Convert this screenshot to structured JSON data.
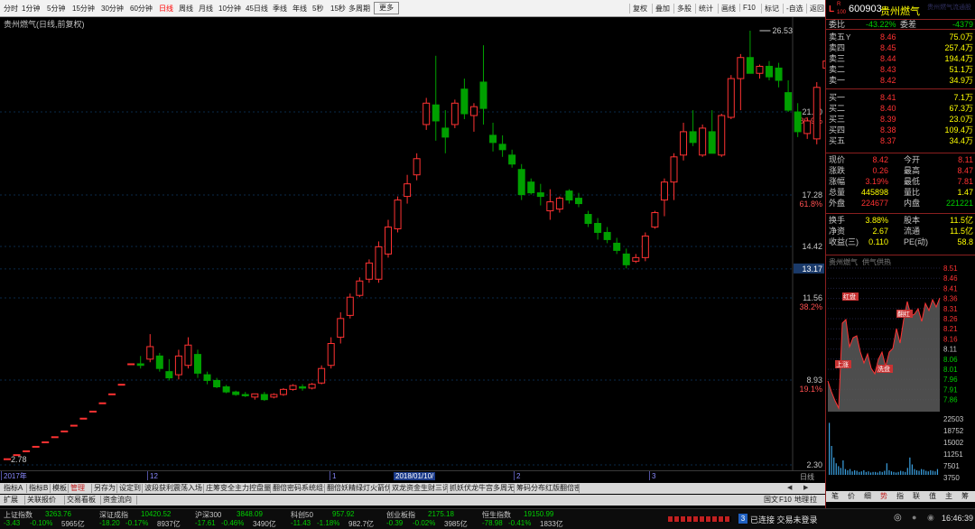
{
  "colors": {
    "up": "#ff3232",
    "down": "#00a000",
    "price": "#ffff00",
    "text": "#c8c8c8",
    "label_red": "#ff5050",
    "label_blue": "#5ab4ff"
  },
  "period_tabs": [
    "分时",
    "1分钟",
    "5分钟",
    "15分钟",
    "30分钟",
    "60分钟",
    "日线",
    "周线",
    "月线",
    "10分钟",
    "45日线",
    "季线",
    "年线",
    "5秒",
    "15秒",
    "多周期",
    "更多"
  ],
  "active_period": "日线",
  "tool_tabs": [
    "复权",
    "叠加",
    "多股",
    "统计",
    "画线",
    "F10",
    "标记",
    "-自选",
    "返回"
  ],
  "chart": {
    "title": "贵州燃气(日线,前复权)",
    "price_labels": [
      {
        "value": "21.90",
        "pct": "80.9%"
      },
      {
        "value": "17.28",
        "pct": "61.8%"
      },
      {
        "value": "14.42",
        "pct": ""
      },
      {
        "value": "13.17",
        "pct": ""
      },
      {
        "value": "11.56",
        "pct": "38.2%"
      },
      {
        "value": "8.93",
        "pct": "19.1%"
      },
      {
        "value": "2.30",
        "pct": ""
      }
    ],
    "high_marker": "26.53",
    "low_marker": "2.78",
    "date_labels": [
      "2017年",
      "12",
      "1",
      "2018/01/10/",
      "2",
      "3"
    ],
    "period_label": "日线"
  },
  "chart_data": {
    "type": "candlestick",
    "title": "贵州燃气(日线,前复权)",
    "y_ticks": [
      2.3,
      8.93,
      11.56,
      14.42,
      17.28,
      21.9
    ],
    "y_range": [
      2.0,
      27.0
    ],
    "current_price_tag": 13.17,
    "high": 26.53,
    "low": 2.78,
    "x_period_labels": [
      "2017年",
      "12",
      "1",
      "2",
      "3"
    ],
    "candles_ohlc": [
      [
        2.78,
        2.78,
        2.78,
        2.78
      ],
      [
        3.1,
        3.1,
        3.1,
        3.1
      ],
      [
        3.4,
        3.4,
        3.4,
        3.4
      ],
      [
        3.75,
        3.75,
        3.75,
        3.75
      ],
      [
        4.1,
        4.1,
        4.1,
        4.1
      ],
      [
        4.5,
        4.5,
        4.5,
        4.5
      ],
      [
        4.95,
        4.95,
        4.95,
        4.95
      ],
      [
        5.4,
        5.4,
        5.4,
        5.4
      ],
      [
        5.95,
        5.95,
        5.95,
        5.95
      ],
      [
        6.5,
        6.5,
        6.5,
        6.5
      ],
      [
        7.15,
        7.15,
        7.15,
        7.15
      ],
      [
        7.85,
        7.85,
        7.85,
        7.85
      ],
      [
        8.6,
        8.6,
        8.6,
        8.6
      ],
      [
        9.45,
        9.45,
        9.45,
        9.45
      ],
      [
        9.45,
        9.7,
        9.3,
        9.4
      ],
      [
        9.6,
        10.4,
        9.5,
        10.0
      ],
      [
        9.7,
        9.8,
        9.2,
        9.3
      ],
      [
        9.2,
        9.6,
        8.9,
        9.0
      ],
      [
        9.1,
        9.9,
        8.95,
        9.7
      ],
      [
        9.4,
        10.3,
        9.3,
        10.05
      ],
      [
        9.75,
        9.9,
        9.0,
        9.15
      ],
      [
        9.1,
        9.2,
        8.6,
        8.9
      ],
      [
        8.9,
        9.0,
        8.3,
        8.4
      ],
      [
        8.4,
        8.55,
        7.9,
        8.0
      ],
      [
        8.0,
        8.1,
        7.7,
        7.8
      ],
      [
        7.8,
        8.0,
        7.6,
        7.7
      ],
      [
        7.6,
        7.8,
        7.4,
        7.85
      ],
      [
        7.8,
        8.0,
        7.3,
        7.4
      ],
      [
        7.6,
        7.9,
        7.5,
        7.8
      ],
      [
        7.8,
        8.3,
        7.7,
        8.2
      ],
      [
        8.2,
        8.6,
        8.1,
        8.5
      ],
      [
        8.4,
        8.6,
        8.1,
        8.3
      ],
      [
        8.3,
        8.7,
        8.2,
        8.6
      ],
      [
        8.7,
        9.4,
        8.6,
        9.3
      ],
      [
        9.4,
        10.3,
        9.3,
        10.1
      ],
      [
        10.3,
        11.1,
        10.1,
        10.9
      ],
      [
        11.0,
        11.8,
        10.9,
        11.6
      ],
      [
        11.7,
        12.7,
        11.6,
        12.5
      ],
      [
        12.6,
        13.7,
        12.4,
        13.5
      ],
      [
        12.6,
        14.7,
        12.4,
        14.4
      ],
      [
        14.0,
        15.9,
        13.8,
        15.5
      ],
      [
        15.4,
        17.2,
        15.2,
        17.0
      ],
      [
        17.2,
        18.4,
        16.8,
        17.9
      ],
      [
        18.4,
        19.6,
        18.1,
        19.3
      ],
      [
        21.2,
        22.7,
        20.9,
        22.4
      ],
      [
        22.3,
        25.1,
        20.3,
        21.4
      ],
      [
        21.0,
        22.0,
        19.6,
        20.5
      ],
      [
        21.2,
        22.6,
        21.0,
        22.4
      ],
      [
        23.2,
        23.8,
        21.5,
        21.8
      ],
      [
        21.7,
        22.4,
        20.8,
        22.2
      ],
      [
        23.6,
        25.7,
        21.2,
        22.1
      ],
      [
        20.6,
        21.3,
        19.7,
        20.2
      ],
      [
        20.1,
        20.6,
        19.4,
        19.8
      ],
      [
        19.5,
        19.8,
        18.8,
        19.0
      ],
      [
        18.7,
        19.0,
        17.0,
        17.3
      ],
      [
        18.0,
        18.2,
        17.3,
        17.4
      ],
      [
        17.4,
        17.9,
        16.7,
        17.2
      ],
      [
        16.4,
        17.6,
        15.9,
        16.9
      ],
      [
        16.5,
        17.2,
        16.3,
        17.1
      ],
      [
        17.5,
        17.6,
        16.8,
        17.0
      ],
      [
        17.1,
        17.4,
        16.6,
        16.8
      ],
      [
        16.2,
        16.4,
        15.5,
        15.7
      ],
      [
        15.7,
        16.0,
        14.8,
        15.2
      ],
      [
        15.2,
        15.5,
        14.6,
        14.8
      ],
      [
        14.6,
        14.9,
        14.0,
        14.2
      ],
      [
        14.0,
        14.3,
        13.2,
        13.4
      ],
      [
        13.6,
        14.0,
        13.5,
        13.8
      ],
      [
        13.8,
        15.2,
        13.6,
        15.0
      ],
      [
        15.5,
        16.4,
        15.4,
        16.3
      ],
      [
        17.0,
        18.2,
        16.1,
        18.0
      ],
      [
        18.0,
        19.6,
        17.0,
        19.4
      ],
      [
        19.5,
        21.3,
        19.2,
        20.8
      ],
      [
        20.8,
        22.0,
        20.0,
        20.2
      ],
      [
        19.5,
        21.2,
        19.4,
        21.0
      ],
      [
        20.8,
        22.0,
        19.8,
        19.6
      ],
      [
        19.5,
        21.8,
        19.4,
        21.7
      ],
      [
        21.6,
        24.0,
        21.5,
        23.8
      ],
      [
        23.8,
        25.2,
        22.0,
        25.0
      ],
      [
        25.0,
        26.53,
        24.1,
        24.1
      ],
      [
        24.1,
        24.6,
        23.8,
        24.5
      ],
      [
        24.5,
        24.8,
        23.7,
        23.9
      ],
      [
        24.4,
        24.7,
        23.3,
        23.7
      ],
      [
        23.0,
        23.7,
        21.9,
        22.0
      ],
      [
        21.9,
        22.4,
        20.5,
        20.8
      ],
      [
        20.7,
        21.6,
        20.4,
        21.4
      ],
      [
        20.4,
        23.6,
        20.1,
        23.3
      ],
      [
        24.4,
        25.5,
        23.9,
        24.8
      ]
    ]
  },
  "bottom_tabs_row1": [
    "指标A",
    "指标B",
    "模板",
    "管理",
    "另存为",
    "设定到",
    "波段获利震荡入场",
    "庄筹变全主力控盘量复",
    "翻倍密码系统组合",
    "翻倍妖精绿灯火箭伏妖",
    "双龙资金生财三词客",
    "抓妖伏龙牛宫多周无敌",
    "筹码分布红版翻倍密码)"
  ],
  "bottom_tabs_row2": [
    "扩展",
    "关联报价",
    "交易看板",
    "资金流向"
  ],
  "quote": {
    "code": "600903",
    "name": "贵州燃气",
    "header_badge_l": "L",
    "header_badge_r": "R",
    "header_badge_num": "100",
    "aside_name": "贵州燃气流通股",
    "weibi_label": "委比",
    "weibi": "-43.22%",
    "weicha_label": "委差",
    "weicha": "-4379",
    "asks": [
      {
        "label": "卖五",
        "flag": "Y",
        "price": "8.46",
        "vol": "75.0万"
      },
      {
        "label": "卖四",
        "flag": "",
        "price": "8.45",
        "vol": "257.4万"
      },
      {
        "label": "卖三",
        "flag": "",
        "price": "8.44",
        "vol": "194.4万"
      },
      {
        "label": "卖二",
        "flag": "",
        "price": "8.43",
        "vol": "51.1万"
      },
      {
        "label": "卖一",
        "flag": "",
        "price": "8.42",
        "vol": "34.9万"
      }
    ],
    "bids": [
      {
        "label": "买一",
        "price": "8.41",
        "vol": "7.1万"
      },
      {
        "label": "买二",
        "price": "8.40",
        "vol": "67.3万"
      },
      {
        "label": "买三",
        "price": "8.39",
        "vol": "23.0万"
      },
      {
        "label": "买四",
        "price": "8.38",
        "vol": "109.4万"
      },
      {
        "label": "买五",
        "price": "8.37",
        "vol": "34.4万"
      }
    ],
    "stats": [
      {
        "l1": "现价",
        "v1": "8.42",
        "l2": "今开",
        "v2": "8.11"
      },
      {
        "l1": "涨跌",
        "v1": "0.26",
        "l2": "最高",
        "v2": "8.47"
      },
      {
        "l1": "涨幅",
        "v1": "3.19%",
        "l2": "最低",
        "v2": "7.81"
      },
      {
        "l1": "总量",
        "v1": "445898",
        "l2": "量比",
        "v2": "1.47"
      },
      {
        "l1": "外盘",
        "v1": "224677",
        "l2": "内盘",
        "v2": "221221"
      }
    ],
    "stats2": [
      {
        "l1": "换手",
        "v1": "3.88%",
        "l2": "股本",
        "v2": "11.5亿"
      },
      {
        "l1": "净资",
        "v1": "2.67",
        "l2": "流通",
        "v2": "11.5亿"
      },
      {
        "l1": "收益(三)",
        "v1": "0.110",
        "l2": "PE(动)",
        "v2": "58.8"
      }
    ]
  },
  "intraday": {
    "title": "贵州燃气",
    "subtitle": "供气供热",
    "price_ticks": [
      "8.51",
      "8.46",
      "8.41",
      "8.36",
      "8.31",
      "8.26",
      "8.21",
      "8.16",
      "8.11",
      "8.06",
      "8.01",
      "7.96",
      "7.91",
      "7.86"
    ],
    "vol_ticks": [
      "22503",
      "18752",
      "15002",
      "11251",
      "7501",
      "3750"
    ],
    "tags": [
      "红盘",
      "翻红",
      "上涨",
      "洗盘"
    ]
  },
  "intraday_tabs": [
    "笔",
    "价",
    "细",
    "势",
    "指",
    "联",
    "值",
    "主",
    "筹"
  ],
  "bottom_right": [
    "国文",
    "F10",
    "地理",
    "拉"
  ],
  "indices": [
    {
      "name": "上证指数",
      "value": "3263.76",
      "chg": "-3.43",
      "pct": "-0.10%",
      "amt": "5965亿"
    },
    {
      "name": "深证成指",
      "value": "10420.52",
      "chg": "-18.20",
      "pct": "-0.17%",
      "amt": "8937亿"
    },
    {
      "name": "沪深300",
      "value": "3848.09",
      "chg": "-17.61",
      "pct": "-0.46%",
      "amt": "3490亿"
    },
    {
      "name": "科创50",
      "value": "957.92",
      "chg": "-11.43",
      "pct": "-1.18%",
      "amt": "982.7亿"
    },
    {
      "name": "创业板指",
      "value": "2175.18",
      "chg": "-0.39",
      "pct": "-0.02%",
      "amt": "3985亿"
    },
    {
      "name": "恒生指数",
      "value": "19150.99",
      "chg": "-78.98",
      "pct": "-0.41%",
      "amt": "1833亿"
    }
  ],
  "status": {
    "conn_badge": "3",
    "conn_text": "已连接 交易未登录",
    "clock": "16:46:39"
  }
}
